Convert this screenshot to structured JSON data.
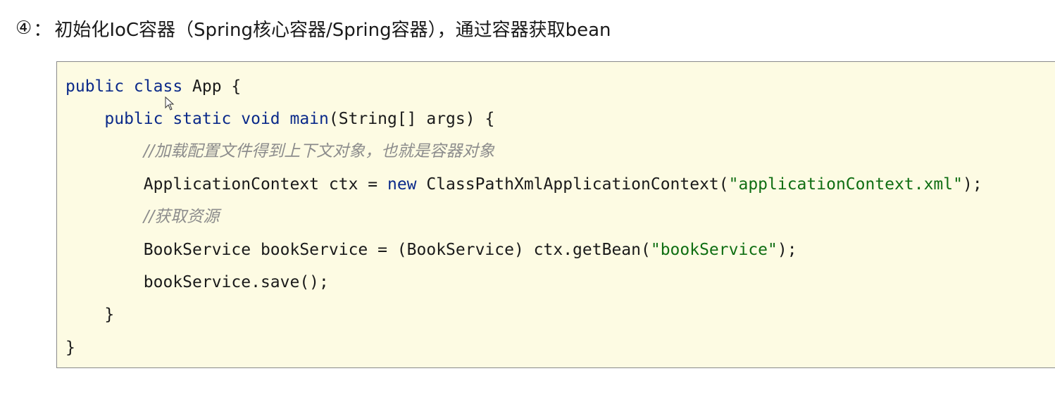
{
  "heading": {
    "step": "④",
    "separator": "：",
    "text": "初始化IoC容器（Spring核心容器/Spring容器），通过容器获取bean"
  },
  "code": {
    "lines": [
      {
        "indent": "",
        "tokens": [
          {
            "t": "kw",
            "v": "public class"
          },
          {
            "t": "plain",
            "v": " App {"
          }
        ]
      },
      {
        "indent": "    ",
        "tokens": [
          {
            "t": "kw",
            "v": "public static void main"
          },
          {
            "t": "plain",
            "v": "(String[] args) {"
          }
        ]
      },
      {
        "indent": "        ",
        "tokens": [
          {
            "t": "cmt",
            "v": "//加载配置文件得到上下文对象，也就是容器对象"
          }
        ]
      },
      {
        "indent": "        ",
        "tokens": [
          {
            "t": "plain",
            "v": "ApplicationContext ctx = "
          },
          {
            "t": "kw",
            "v": "new"
          },
          {
            "t": "plain",
            "v": " ClassPathXmlApplicationContext("
          },
          {
            "t": "str",
            "v": "\"applicationContext.xml\""
          },
          {
            "t": "plain",
            "v": ");"
          }
        ]
      },
      {
        "indent": "        ",
        "tokens": [
          {
            "t": "cmt",
            "v": "//获取资源"
          }
        ]
      },
      {
        "indent": "        ",
        "tokens": [
          {
            "t": "plain",
            "v": "BookService bookService = (BookService) ctx.getBean("
          },
          {
            "t": "str",
            "v": "\"bookService\""
          },
          {
            "t": "plain",
            "v": ");"
          }
        ]
      },
      {
        "indent": "        ",
        "tokens": [
          {
            "t": "plain",
            "v": "bookService.save();"
          }
        ]
      },
      {
        "indent": "    ",
        "tokens": [
          {
            "t": "plain",
            "v": "}"
          }
        ]
      },
      {
        "indent": "",
        "tokens": [
          {
            "t": "plain",
            "v": "}"
          }
        ]
      }
    ]
  },
  "colors": {
    "keyword": "#0b2a8a",
    "string": "#0f6e12",
    "comment": "#8c8c8c",
    "code_background": "#fdfbe3"
  },
  "icons": {
    "cursor": "mouse-pointer-icon"
  }
}
